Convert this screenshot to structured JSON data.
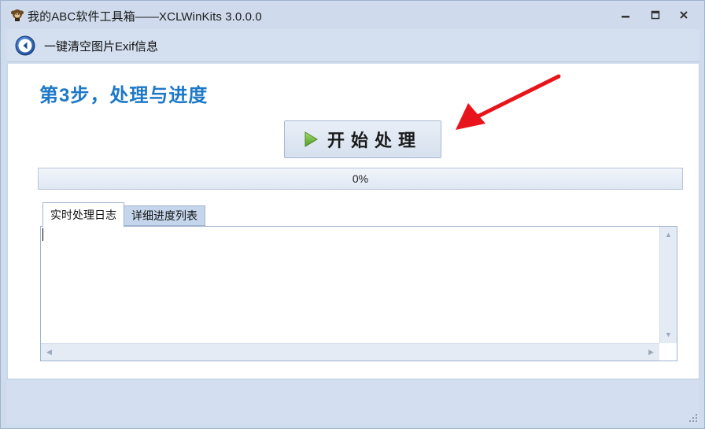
{
  "window": {
    "title": "我的ABC软件工具箱——XCLWinKits  3.0.0.0",
    "icon": "monkey-app-icon",
    "controls": {
      "minimize": "minimize-icon",
      "maximize": "maximize-icon",
      "close": "close-icon"
    }
  },
  "nav": {
    "back_icon": "back-arrow-icon",
    "title": "一键清空图片Exif信息"
  },
  "main": {
    "step_title_prefix": "第",
    "step_number": "3",
    "step_title_suffix": "步，处理与进度",
    "start_button": {
      "label": "开始处理",
      "icon": "play-icon"
    },
    "annotation_arrow": {
      "color": "#e8141b"
    },
    "progress": {
      "value": 0,
      "text": "0%"
    }
  },
  "tabs": [
    {
      "label": "实时处理日志",
      "active": true
    },
    {
      "label": "详细进度列表",
      "active": false
    }
  ],
  "log": {
    "content": ""
  },
  "colors": {
    "accent": "#1e78c8",
    "chrome": "#cfdcee",
    "arrow": "#e8141b",
    "play": "#7cc24a"
  }
}
